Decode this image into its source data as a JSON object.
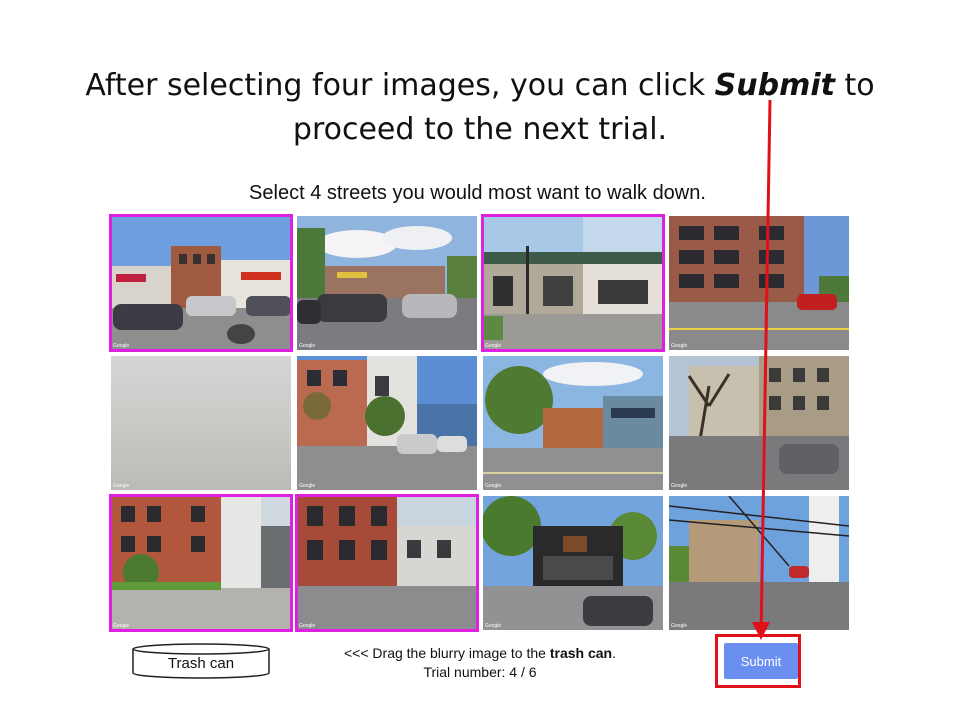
{
  "headline": {
    "part1": "After selecting four images, you can click ",
    "emph": "Submit",
    "part2": " to",
    "line2": "proceed to the next trial."
  },
  "prompt": "Select 4 streets you would most want to walk down.",
  "tiles": [
    {
      "label": "Street image 1",
      "selected": true
    },
    {
      "label": "Street image 2",
      "selected": false
    },
    {
      "label": "Street image 3",
      "selected": true
    },
    {
      "label": "Street image 4",
      "selected": false
    },
    {
      "label": "Street image 5 (blurry)",
      "selected": false
    },
    {
      "label": "Street image 6",
      "selected": false
    },
    {
      "label": "Street image 7",
      "selected": false
    },
    {
      "label": "Street image 8",
      "selected": false
    },
    {
      "label": "Street image 9",
      "selected": true
    },
    {
      "label": "Street image 10",
      "selected": true
    },
    {
      "label": "Street image 11",
      "selected": false
    },
    {
      "label": "Street image 12",
      "selected": false
    }
  ],
  "watermark": "Google",
  "trash_label": "Trash can",
  "instructions": {
    "pre": "<<< Drag the blurry image to the ",
    "bold": "trash can",
    "post": ".",
    "trial": "Trial number: 4 / 6"
  },
  "submit_label": "Submit",
  "colors": {
    "selection": "#e020e0",
    "annotation": "#e0101a",
    "submit_bg": "#6b8ff0"
  }
}
